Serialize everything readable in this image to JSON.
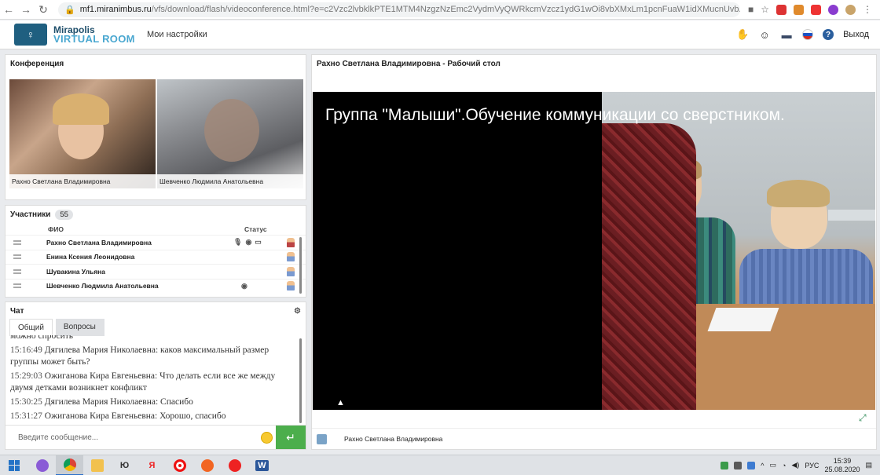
{
  "browser": {
    "url_domain": "mf1.miranimbus.ru",
    "url_path": "/vfs/download/flash/videoconference.html?e=c2Vzc2lvbklkPTE1MTM4NzgzNzEmc2VydmVyQWRkcmVzcz1ydG1wOi8vbXMxLm1pcnFuaW1idXMucnUvbXMvJGJoUHBxTWt..."
  },
  "header": {
    "logo_top": "Mirapolis",
    "logo_bottom": "VIRTUAL ROOM",
    "settings_label": "Мои настройки",
    "exit_label": "Выход",
    "help_label": "?"
  },
  "conference": {
    "title": "Конференция",
    "tiles": [
      {
        "name": "Рахно Светлана Владимировна"
      },
      {
        "name": "Шевченко  Людмила  Анатольевна"
      }
    ]
  },
  "participants": {
    "title": "Участники",
    "count": "55",
    "col_name": "ФИО",
    "col_status": "Статус",
    "rows": [
      {
        "name": "Рахно Светлана Владимировна"
      },
      {
        "name": "Енина Ксения  Леонидовна"
      },
      {
        "name": "Шувакина Ульяна"
      },
      {
        "name": "Шевченко  Людмила  Анатольевна"
      }
    ]
  },
  "chat": {
    "title": "Чат",
    "tab_general": "Общий",
    "tab_questions": "Вопросы",
    "partial_line": "можно спросить",
    "messages": [
      {
        "time": "15:16:49",
        "author": "Дягилева Мария Николаевна:",
        "text": "каков максимальный размер группы может быть?"
      },
      {
        "time": "15:29:03",
        "author": "Ожиганова  Кира Евгеньевна:",
        "text": "Что делать если все же между двумя детками возникнет конфликт"
      },
      {
        "time": "15:30:25",
        "author": "Дягилева Мария Николаевна:",
        "text": "Спасибо"
      },
      {
        "time": "15:31:27",
        "author": "Ожиганова  Кира Евгеньевна:",
        "text": "Хорошо, спасибо"
      }
    ],
    "input_placeholder": "Введите сообщение...",
    "send_icon": "↵"
  },
  "desktop": {
    "title": "Рахно Светлана Владимировна - Рабочий стол",
    "caption": "Группа \"Малыши\".Обучение коммуникации со сверстником.",
    "presenter": "Рахно Светлана Владимировна"
  },
  "taskbar": {
    "apps": [
      "Алиса",
      "Chrome",
      "Проводник",
      "Ю",
      "Я",
      "Opera",
      "Медиа",
      "Яндекс",
      "Word"
    ],
    "lang": "РУС",
    "time": "15:39",
    "date": "25.08.2020"
  },
  "colors": {
    "brand": "#1f5f80",
    "brand_accent": "#49a7d0",
    "send_button": "#4cae4c"
  }
}
